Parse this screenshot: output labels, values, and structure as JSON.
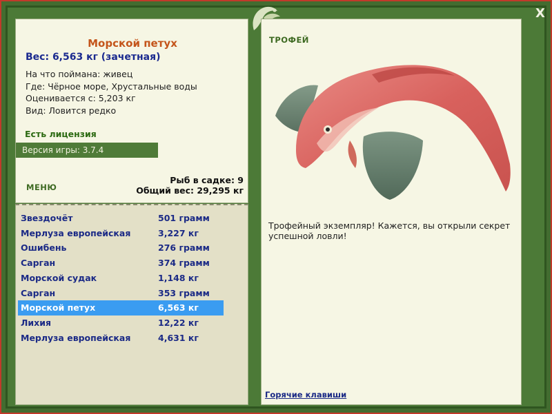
{
  "window": {
    "close_label": "X"
  },
  "fish": {
    "title": "Морской петух",
    "weight_line": "Вес: 6,563 кг (зачетная)",
    "bait_line": "На что поймана: живец",
    "location_line": "Где: Чёрное море, Хрустальные воды",
    "valued_line": "Оценивается с: 5,203 кг",
    "kind_line": "Вид: Ловится редко"
  },
  "license_label": "Есть лицензия",
  "version_label": "Версия игры: 3.7.4",
  "menu_label": "МЕНЮ",
  "stats": {
    "count_line": "Рыб в садке: 9",
    "total_line": "Общий вес: 29,295 кг"
  },
  "catches": [
    {
      "name": "Звездочёт",
      "weight": "501 грамм"
    },
    {
      "name": "Мерлуза европейская",
      "weight": "3,227 кг"
    },
    {
      "name": "Ошибень",
      "weight": "276 грамм"
    },
    {
      "name": "Сарган",
      "weight": "374 грамм"
    },
    {
      "name": "Морской судак",
      "weight": "1,148 кг"
    },
    {
      "name": "Сарган",
      "weight": "353 грамм"
    },
    {
      "name": "Морской петух",
      "weight": "6,563 кг"
    },
    {
      "name": "Лихия",
      "weight": "12,22 кг"
    },
    {
      "name": "Мерлуза европейская",
      "weight": "4,631 кг"
    }
  ],
  "selected_index": 6,
  "trophy": {
    "label": "ТРОФЕЙ",
    "text": "Трофейный экземпляр! Кажется, вы открыли секрет успешной ловли!"
  },
  "hotkeys_label": "Горячие клавиши",
  "colors": {
    "frame": "#436c30",
    "panel": "#f6f6e4",
    "list_bg": "#e3e0c7",
    "selected": "#3a9cf1",
    "title": "#c4551b",
    "link": "#1b2a86"
  }
}
